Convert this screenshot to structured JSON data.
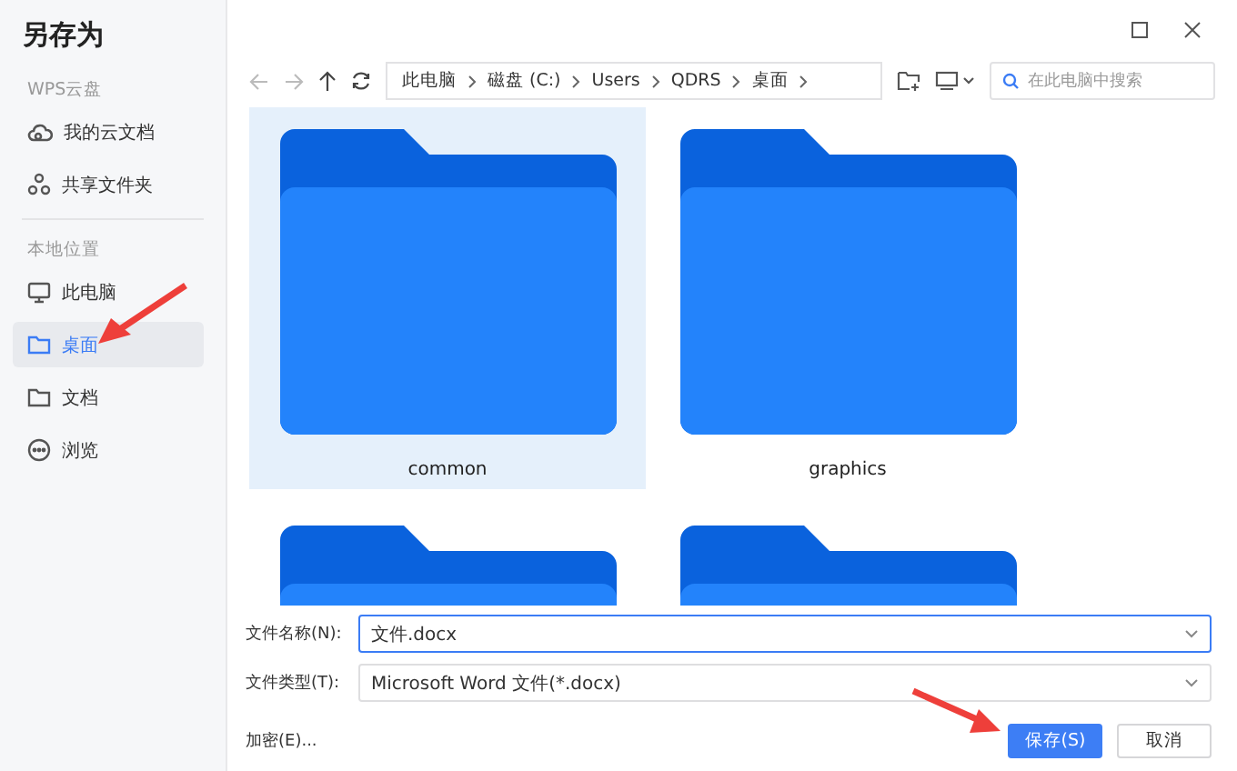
{
  "window": {
    "title": "另存为"
  },
  "sidebar": {
    "sections": [
      {
        "title": "WPS云盘",
        "items": [
          {
            "label": "我的云文档",
            "kind": "cloud",
            "selected": false
          },
          {
            "label": "共享文件夹",
            "kind": "share",
            "selected": false
          }
        ]
      },
      {
        "title": "本地位置",
        "items": [
          {
            "label": "此电脑",
            "kind": "monitor",
            "selected": false
          },
          {
            "label": "桌面",
            "kind": "folder",
            "selected": true
          },
          {
            "label": "文档",
            "kind": "folder",
            "selected": false
          },
          {
            "label": "浏览",
            "kind": "more",
            "selected": false
          }
        ]
      }
    ]
  },
  "breadcrumb": [
    "此电脑",
    "磁盘 (C:)",
    "Users",
    "QDRS",
    "桌面"
  ],
  "search": {
    "placeholder": "在此电脑中搜索"
  },
  "folders": [
    {
      "name": "common",
      "selected": true
    },
    {
      "name": "graphics",
      "selected": false
    },
    {
      "selected": false
    },
    {
      "selected": false
    }
  ],
  "form": {
    "filename_label": "文件名称(N):",
    "filename": "文件.docx",
    "filetype_label": "文件类型(T):",
    "filetype": "Microsoft Word 文件(*.docx)"
  },
  "encrypt_link": "加密(E)...",
  "buttons": {
    "save": "保存(S)",
    "cancel": "取消"
  }
}
